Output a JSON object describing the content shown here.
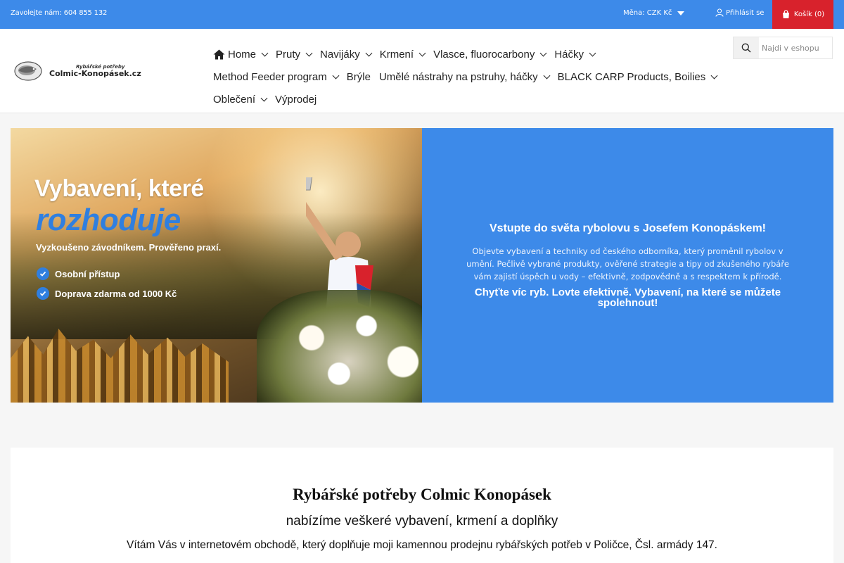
{
  "topbar": {
    "contact": "Zavolejte nám: 604 855 132",
    "currency": "Měna: CZK Kč",
    "login": "Přihlásit se",
    "cart": "Košík (0)"
  },
  "logo": {
    "small": "Rybářské potřeby",
    "big": "Colmic-Konopásek.cz"
  },
  "nav": {
    "row1": [
      "Home",
      "Pruty",
      "Navijáky",
      "Krmení",
      "Vlasce, fluorocarbony",
      "Háčky"
    ],
    "row2": [
      "Method Feeder program",
      "Brýle",
      "Umělé nástrahy na pstruhy, háčky",
      "BLACK CARP Products, Boilies"
    ],
    "row3": [
      "Oblečení",
      "Výprodej"
    ]
  },
  "search": {
    "placeholder": "Najdi v eshopu"
  },
  "hero": {
    "image_title1": "Vybavení, které",
    "image_title2": "rozhoduje",
    "image_sub": "Vyzkoušeno závodníkem. Prověřeno praxí.",
    "image_check1": "Osobní přístup",
    "image_check2": "Doprava zdarma od 1000 Kč",
    "heading": "Vstupte do světa rybolovu s Josefem Konopáskem!",
    "paragraph": "Objevte vybavení a techniky od českého odborníka, který proměnil rybolov v umění. Pečlivě vybrané produkty, ověřené strategie a tipy od zkušeného rybáře vám zajistí úspěch u vody – efektivně, zodpovědně a s respektem k přírodě.",
    "cta": "Chyťte víc ryb. Lovte efektivně. Vybavení, na které se můžete spolehnout!"
  },
  "content": {
    "title": "Rybářské potřeby Colmic Konopásek",
    "subtitle": "nabízíme veškeré vybavení, krmení a doplňky",
    "text": "Vítám Vás v internetovém obchodě, který doplňuje moji kamennou prodejnu rybářských potřeb v Poličce, Čsl. armády 147."
  },
  "colors": {
    "primary": "#3d8ae9",
    "cart": "#d8222c"
  }
}
